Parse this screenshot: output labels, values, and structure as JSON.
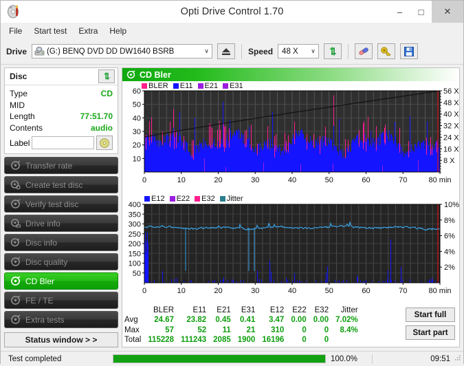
{
  "window": {
    "title": "Opti Drive Control 1.70",
    "minimize": "–",
    "maximize": "□",
    "close": "✕"
  },
  "menu": [
    "File",
    "Start test",
    "Extra",
    "Help"
  ],
  "toolbar": {
    "drive_label": "Drive",
    "drive_value": "(G:)   BENQ DVD DD DW1640 BSRB",
    "speed_label": "Speed",
    "speed_value": "48 X",
    "arrow": "∨",
    "icons": [
      "eject-icon",
      "refresh-icon",
      "erase-icon",
      "key-icon",
      "save-icon"
    ]
  },
  "disc": {
    "header": "Disc",
    "rows": [
      {
        "key": "Type",
        "value": "CD"
      },
      {
        "key": "MID",
        "value": ""
      },
      {
        "key": "Length",
        "value": "77:51.70"
      },
      {
        "key": "Contents",
        "value": "audio"
      }
    ],
    "label_key": "Label",
    "label_value": "",
    "label_placeholder": ""
  },
  "sidebar": {
    "items": [
      {
        "label": "Transfer rate",
        "active": false
      },
      {
        "label": "Create test disc",
        "active": false
      },
      {
        "label": "Verify test disc",
        "active": false
      },
      {
        "label": "Drive info",
        "active": false
      },
      {
        "label": "Disc info",
        "active": false
      },
      {
        "label": "Disc quality",
        "active": false
      },
      {
        "label": "CD Bler",
        "active": true
      },
      {
        "label": "FE / TE",
        "active": false
      },
      {
        "label": "Extra tests",
        "active": false
      }
    ],
    "status_window": "Status window > >"
  },
  "panel": {
    "title": "CD Bler"
  },
  "stats": {
    "columns": [
      "BLER",
      "E11",
      "E21",
      "E31",
      "E12",
      "E22",
      "E32",
      "Jitter"
    ],
    "rows": [
      {
        "label": "Avg",
        "values": [
          "24.67",
          "23.82",
          "0.45",
          "0.41",
          "3.47",
          "0.00",
          "0.00",
          "7.02%"
        ]
      },
      {
        "label": "Max",
        "values": [
          "57",
          "52",
          "11",
          "21",
          "310",
          "0",
          "0",
          "8.4%"
        ]
      },
      {
        "label": "Total",
        "values": [
          "115228",
          "111243",
          "2085",
          "1900",
          "16196",
          "0",
          "0",
          ""
        ]
      }
    ]
  },
  "actions": {
    "start_full": "Start full",
    "start_part": "Start part"
  },
  "statusbar": {
    "message": "Test completed",
    "percent": "100.0%",
    "progress_value": 100,
    "time": "09:51"
  },
  "colors": {
    "accent_green": "#12a112",
    "bler": "#ff1e8c",
    "e11": "#1414ff",
    "e21": "#9b1ee0",
    "e31": "#9b1ee0",
    "e12": "#1414ff",
    "e22": "#9b1ee0",
    "e32": "#ff1e8c",
    "jitter": "#3aa0e0",
    "plot_bg": "#2d2d2d",
    "value_green": "#0e9e0e"
  },
  "chart_data": [
    {
      "type": "line",
      "name": "cd-bler-errors-chart",
      "title": "CD Bler",
      "xlabel": "min",
      "ylabel": "",
      "x": [
        0,
        80
      ],
      "xlim": [
        0,
        80
      ],
      "xticks": [
        0,
        10,
        20,
        30,
        40,
        50,
        60,
        70,
        80
      ],
      "xticklabels": [
        "0",
        "10",
        "20",
        "30",
        "40",
        "50",
        "60",
        "70",
        "80 min"
      ],
      "ylim": [
        0,
        60
      ],
      "yticks": [
        10,
        20,
        30,
        40,
        50,
        60
      ],
      "y2lim": [
        0,
        60
      ],
      "y2ticks": [
        8,
        16,
        24,
        32,
        40,
        48,
        56
      ],
      "y2ticklabels": [
        "8 X",
        "16 X",
        "24 X",
        "32 X",
        "40 X",
        "48 X",
        "56 X"
      ],
      "grid": true,
      "legend": [
        {
          "label": "BLER",
          "color": "#ff1e8c"
        },
        {
          "label": "E11",
          "color": "#1414ff"
        },
        {
          "label": "E21",
          "color": "#9b1ee0"
        },
        {
          "label": "E31",
          "color": "#9b1ee0"
        }
      ],
      "legend_position": "top-left",
      "series": [
        {
          "name": "E11",
          "color": "#1414ff",
          "avg": 23.82,
          "max": 52,
          "total": 111243
        },
        {
          "name": "BLER",
          "color": "#ff1e8c",
          "avg": 24.67,
          "max": 57,
          "total": 115228
        },
        {
          "name": "E21",
          "color": "#9b1ee0",
          "avg": 0.45,
          "max": 11,
          "total": 2085
        },
        {
          "name": "E31",
          "color": "#9b1ee0",
          "avg": 0.41,
          "max": 21,
          "total": 1900
        }
      ],
      "speed_curve_note": "read speed ramps from ~24X to 56X across the disc"
    },
    {
      "type": "line",
      "name": "cd-bler-e12-jitter-chart",
      "xlabel": "min",
      "ylabel": "",
      "xlim": [
        0,
        80
      ],
      "xticks": [
        0,
        10,
        20,
        30,
        40,
        50,
        60,
        70,
        80
      ],
      "xticklabels": [
        "0",
        "10",
        "20",
        "30",
        "40",
        "50",
        "60",
        "70",
        "80 min"
      ],
      "ylim": [
        0,
        400
      ],
      "yticks": [
        50,
        100,
        150,
        200,
        250,
        300,
        350,
        400
      ],
      "y2lim": [
        0,
        400
      ],
      "y2ticks": [
        80,
        160,
        240,
        320,
        400
      ],
      "y2ticklabels": [
        "2%",
        "4%",
        "6%",
        "8%",
        "10%"
      ],
      "grid": true,
      "legend": [
        {
          "label": "E12",
          "color": "#1414ff"
        },
        {
          "label": "E22",
          "color": "#9b1ee0"
        },
        {
          "label": "E32",
          "color": "#ff1e8c"
        },
        {
          "label": "Jitter",
          "color": "#2b7f8c"
        }
      ],
      "legend_position": "top-left",
      "series": [
        {
          "name": "E12",
          "color": "#1414ff",
          "avg": 3.47,
          "max": 310,
          "total": 16196
        },
        {
          "name": "E22",
          "color": "#9b1ee0",
          "avg": 0.0,
          "max": 0,
          "total": 0
        },
        {
          "name": "E32",
          "color": "#ff1e8c",
          "avg": 0.0,
          "max": 0,
          "total": 0
        },
        {
          "name": "Jitter",
          "color": "#3aa0e0",
          "avg": "7.02%",
          "max": "8.4%",
          "baseline": 281
        }
      ]
    }
  ]
}
